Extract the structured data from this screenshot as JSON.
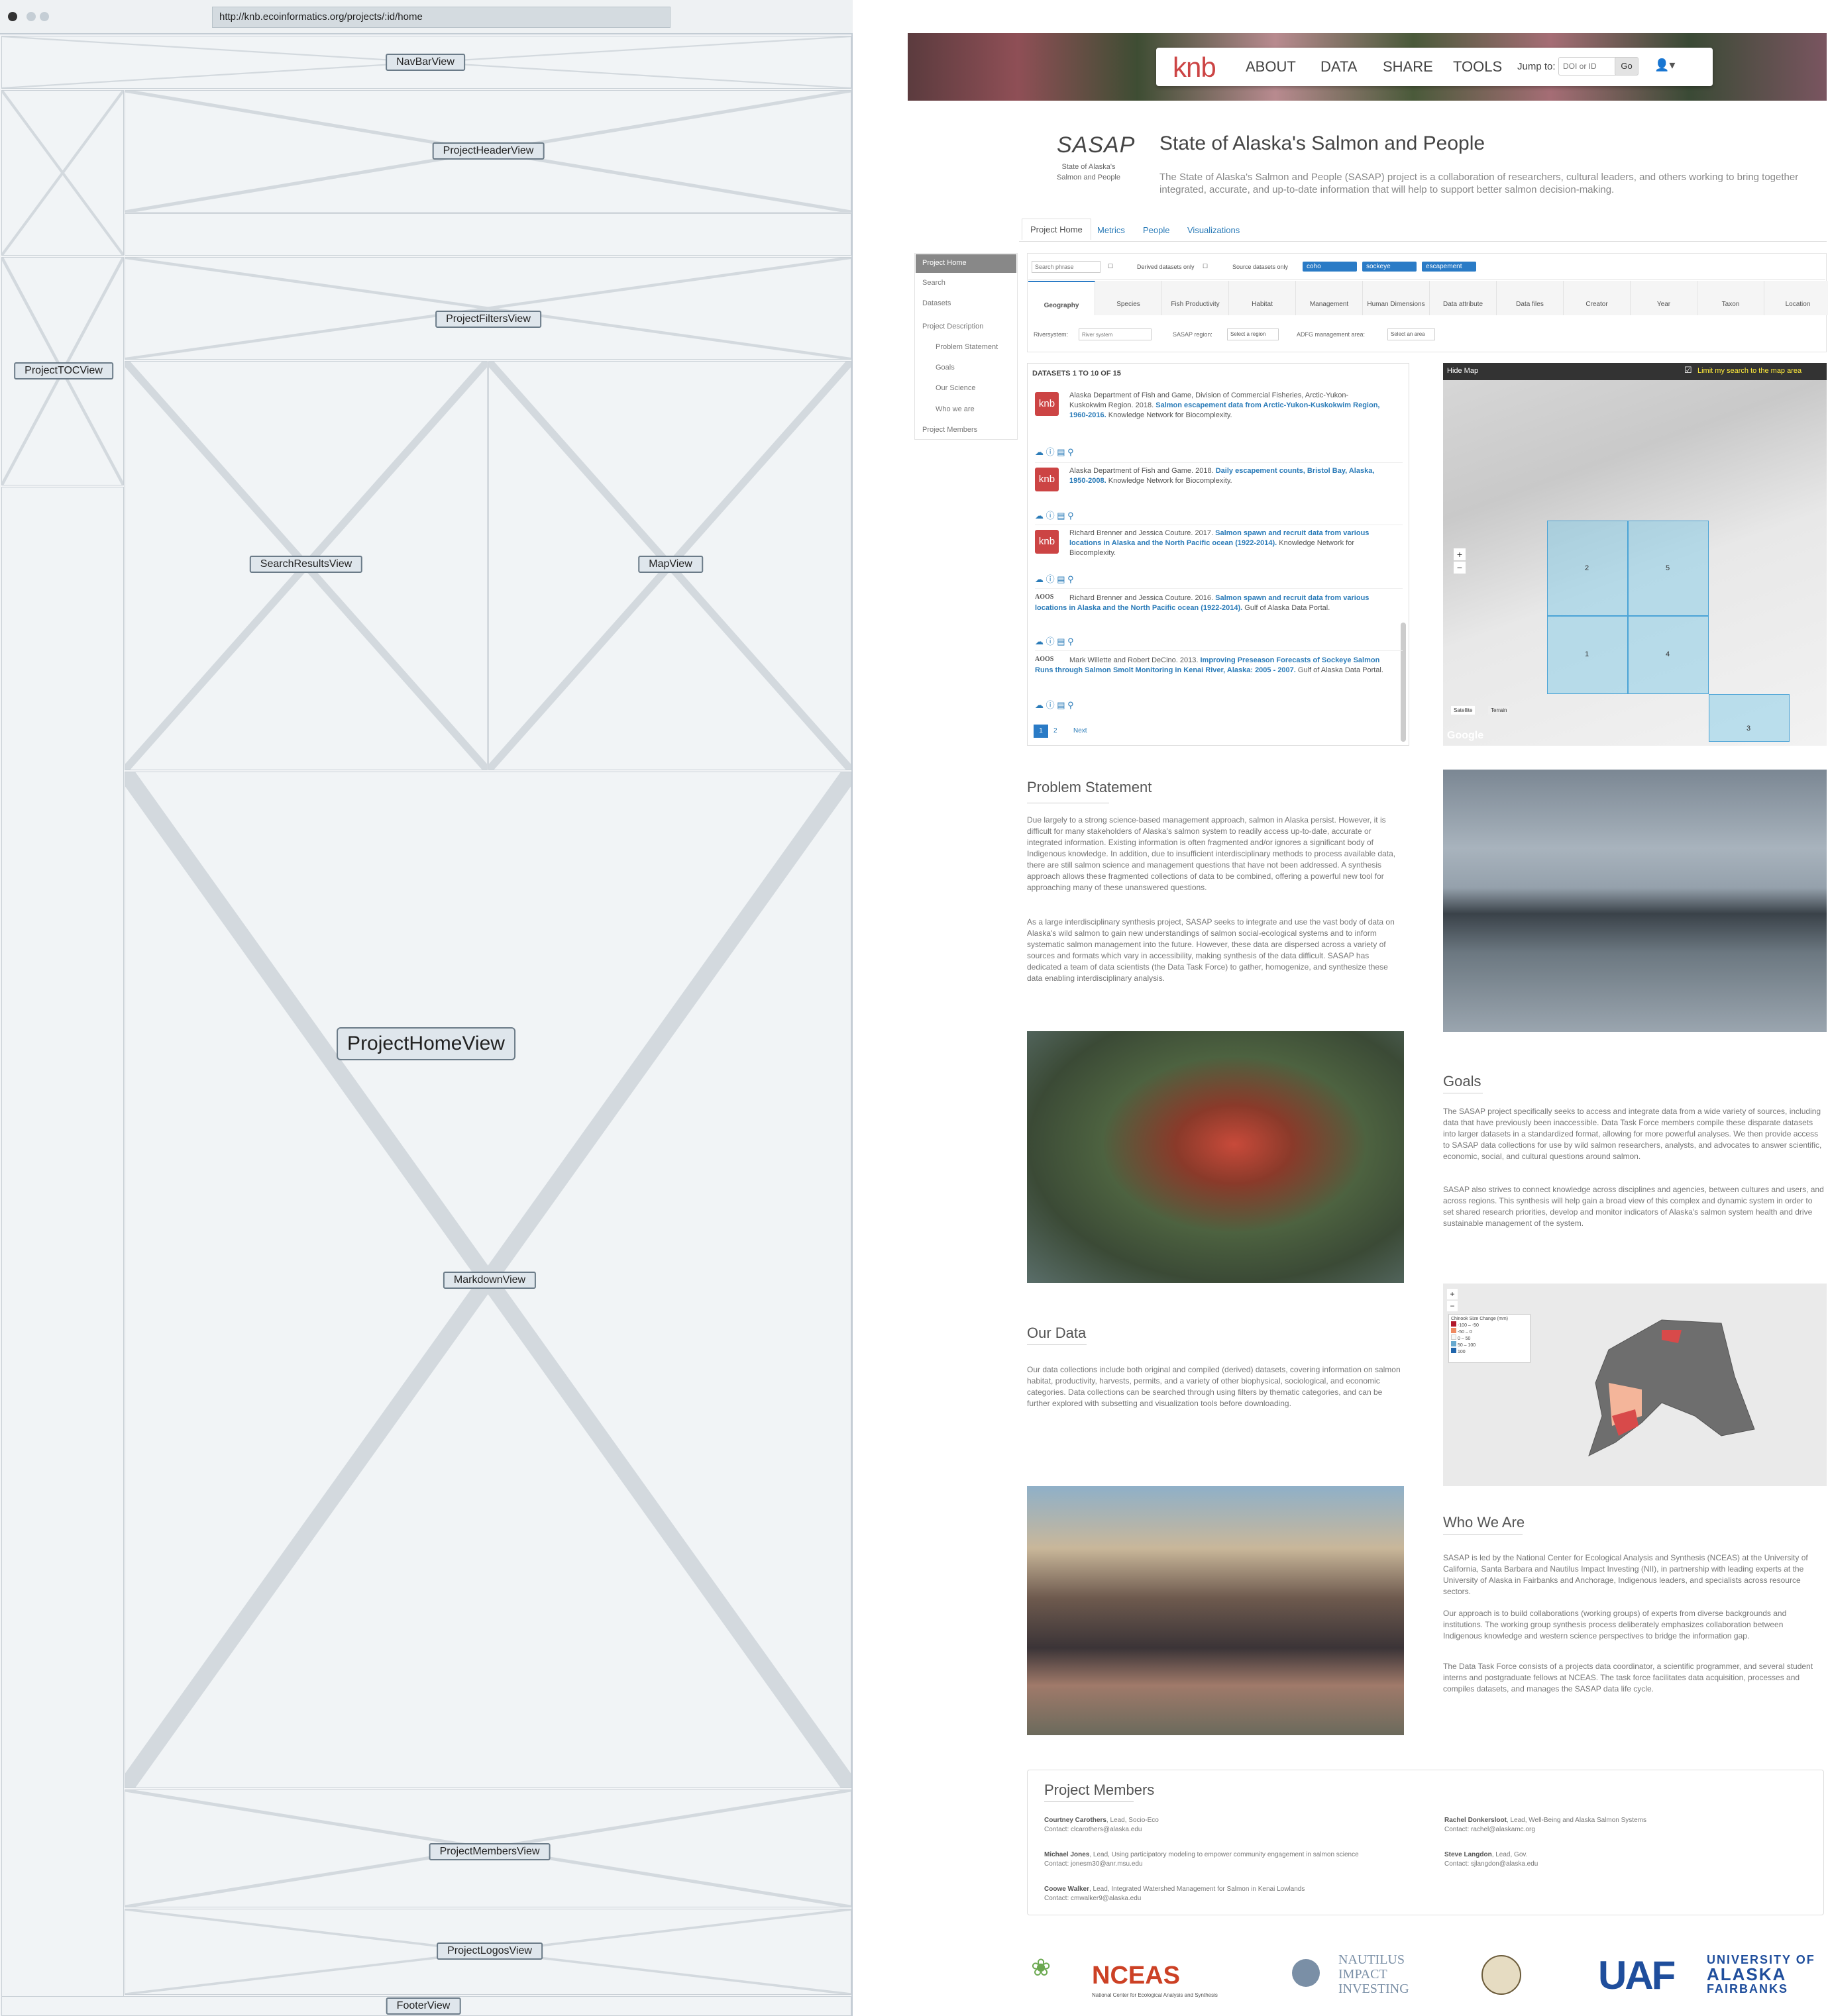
{
  "browser": {
    "url": "http://knb.ecoinformatics.org/projects/:id/home"
  },
  "wireframe": {
    "labels": {
      "navbar": "NavBarView",
      "header": "ProjectHeaderView",
      "toc": "ProjectTOCView",
      "filters": "ProjectFiltersView",
      "search": "SearchResultsView",
      "map": "MapView",
      "home": "ProjectHomeView",
      "markdown": "MarkdownView",
      "members": "ProjectMembersView",
      "logos": "ProjectLogosView",
      "footer": "FooterView"
    }
  },
  "navbar": {
    "logo": "knb",
    "items": [
      "ABOUT",
      "DATA",
      "SHARE",
      "TOOLS"
    ],
    "jump_label": "Jump to:",
    "jump_placeholder": "DOI or ID",
    "go_label": "Go"
  },
  "project": {
    "logo": "SASAP",
    "logo_sub": "State of Alaska's Salmon and People",
    "title": "State of Alaska's Salmon and People",
    "description": "The State of Alaska's Salmon and People (SASAP) project is a collaboration of researchers, cultural leaders, and others working to bring together integrated, accurate, and up-to-date information that will help to support better salmon decision-making."
  },
  "tabs": [
    "Project Home",
    "Metrics",
    "People",
    "Visualizations"
  ],
  "toc": [
    "Project Home",
    "Search",
    "Datasets",
    "Project Description",
    "Problem Statement",
    "Goals",
    "Our Science",
    "Who we are",
    "Project Members"
  ],
  "filters": {
    "search_placeholder": "Search phrase",
    "derived_label": "Derived datasets only",
    "source_label": "Source datasets only",
    "active": [
      "coho",
      "sockeye",
      "escapement"
    ],
    "categories": [
      "Geography",
      "Species",
      "Fish Productivity",
      "Habitat",
      "Management",
      "Human Dimensions",
      "Data attribute",
      "Data files",
      "Creator",
      "Year",
      "Taxon",
      "Location"
    ],
    "river_label": "Riversystem:",
    "river_placeholder": "River system",
    "region_label": "SASAP region:",
    "region_value": "Select a region",
    "adfg_label": "ADFG management area:",
    "adfg_value": "Select an area"
  },
  "results": {
    "heading": "DATASETS 1 TO 10 OF 15",
    "items": [
      {
        "src": "knb",
        "authors": "Alaska Department of Fish and Game, Division of Commercial Fisheries, Arctic-Yukon-Kuskokwim Region. 2018.",
        "title": "Salmon escapement data from Arctic-Yukon-Kuskokwim Region, 1960-2016.",
        "rest": "Knowledge Network for Biocomplexity."
      },
      {
        "src": "knb",
        "authors": "Alaska Department of Fish and Game. 2018.",
        "title": "Daily escapement counts, Bristol Bay, Alaska, 1950-2008.",
        "rest": "Knowledge Network for Biocomplexity."
      },
      {
        "src": "knb",
        "authors": "Richard Brenner and Jessica Couture. 2017.",
        "title": "Salmon spawn and recruit data from various locations in Alaska and the North Pacific ocean (1922-2014).",
        "rest": "Knowledge Network for Biocomplexity."
      },
      {
        "src": "AOOS",
        "authors": "Richard Brenner and Jessica Couture. 2016.",
        "title": "Salmon spawn and recruit data from various locations in Alaska and the North Pacific ocean (1922-2014).",
        "rest": "Gulf of Alaska Data Portal."
      },
      {
        "src": "AOOS",
        "authors": "Mark Willette and Robert DeCino. 2013.",
        "title": "Improving Preseason Forecasts of Sockeye Salmon Runs through Salmon Smolt Monitoring in Kenai River, Alaska: 2005 - 2007.",
        "rest": "Gulf of Alaska Data Portal."
      }
    ],
    "pages": [
      "1",
      "2",
      "Next"
    ]
  },
  "map": {
    "hide": "Hide Map",
    "limit": "Limit my search to the map area",
    "zoom_in": "+",
    "zoom_out": "−",
    "satellite": "Satellite",
    "terrain": "Terrain",
    "google": "Google",
    "cells": [
      "2",
      "5",
      "1",
      "4",
      "3"
    ]
  },
  "sections": {
    "problem": {
      "heading": "Problem Statement",
      "p1": "Due largely to a strong science-based management approach, salmon in Alaska persist. However, it is difficult for many stakeholders of Alaska's salmon system to readily access up-to-date, accurate or integrated information. Existing information is often fragmented and/or ignores a significant body of Indigenous knowledge. In addition, due to insufficient interdisciplinary methods to process available data, there are still salmon science and management questions that have not been addressed. A synthesis approach allows these fragmented collections of data to be combined, offering a powerful new tool for approaching many of these unanswered questions.",
      "p2": "As a large interdisciplinary synthesis project, SASAP seeks to integrate and use the vast body of data on Alaska's wild salmon to gain new understandings of salmon social-ecological systems and to inform systematic salmon management into the future. However, these data are dispersed across a variety of sources and formats which vary in accessibility, making synthesis of the data difficult. SASAP has dedicated a team of data scientists (the Data Task Force) to gather, homogenize, and synthesize these data enabling interdisciplinary analysis."
    },
    "goals": {
      "heading": "Goals",
      "p1": "The SASAP project specifically seeks to access and integrate data from a wide variety of sources, including data that have previously been inaccessible. Data Task Force members compile these disparate datasets into larger datasets in a standardized format, allowing for more powerful analyses. We then provide access to SASAP data collections for use by wild salmon researchers, analysts, and advocates to answer scientific, economic, social, and cultural questions around salmon.",
      "p2": "SASAP also strives to connect knowledge across disciplines and agencies, between cultures and users, and across regions. This synthesis will help gain a broad view of this complex and dynamic system in order to set shared research priorities, develop and monitor indicators of Alaska's salmon system health and drive sustainable management of the system."
    },
    "data": {
      "heading": "Our Data",
      "p1": "Our data collections include both original and compiled (derived) datasets, covering information on salmon habitat, productivity, harvests, permits, and a variety of other biophysical, sociological, and economic categories. Data collections can be searched through using filters by thematic categories, and can be further explored with subsetting and visualization tools before downloading."
    },
    "who": {
      "heading": "Who We Are",
      "p1": "SASAP is led by the National Center for Ecological Analysis and Synthesis (NCEAS) at the University of California, Santa Barbara and Nautilus Impact Investing (NII), in partnership with leading experts at the University of Alaska in Fairbanks and Anchorage, Indigenous leaders, and specialists across resource sectors.",
      "p2": "Our approach is to build collaborations (working groups) of experts from diverse backgrounds and institutions. The working group synthesis process deliberately emphasizes collaboration between Indigenous knowledge and western science perspectives to bridge the information gap.",
      "p3": "The Data Task Force consists of a projects data coordinator, a scientific programmer, and several student interns and postgraduate fellows at NCEAS. The task force facilitates data acquisition, processes and compiles datasets, and manages the SASAP data life cycle."
    }
  },
  "members": {
    "heading": "Project Members",
    "list": [
      {
        "name": "Courtney Carothers",
        "role": "Lead, Socio-Eco",
        "contact": "Contact: clcarothers@alaska.edu"
      },
      {
        "name": "Rachel Donkersloot",
        "role": "Lead, Well-Being and Alaska Salmon Systems",
        "contact": "Contact: rachel@alaskamc.org"
      },
      {
        "name": "Michael Jones",
        "role": "Lead, Using participatory modeling to empower community engagement in salmon science",
        "contact": "Contact: jonesm30@anr.msu.edu"
      },
      {
        "name": "Steve Langdon",
        "role": "Lead, Gov.",
        "contact": "Contact: sjlangdon@alaska.edu"
      },
      {
        "name": "Coowe Walker",
        "role": "Lead, Integrated Watershed Management for Salmon in Kenai Lowlands",
        "contact": "Contact: cmwalker9@alaska.edu"
      }
    ]
  },
  "logos": {
    "nceas": "NCEAS",
    "nceas_sub": "National Center for Ecological Analysis and Synthesis",
    "nautilus": [
      "NAUTILUS",
      "IMPACT",
      "INVESTING"
    ],
    "uaf": "UAF",
    "uaf_text": [
      "UNIVERSITY OF",
      "ALASKA",
      "FAIRBANKS"
    ]
  },
  "legend": {
    "title": "Chinook Size Change (mm)",
    "items": [
      "-100 – -50",
      "-50 – 0",
      "0 – 50",
      "50 – 100",
      "100"
    ]
  }
}
